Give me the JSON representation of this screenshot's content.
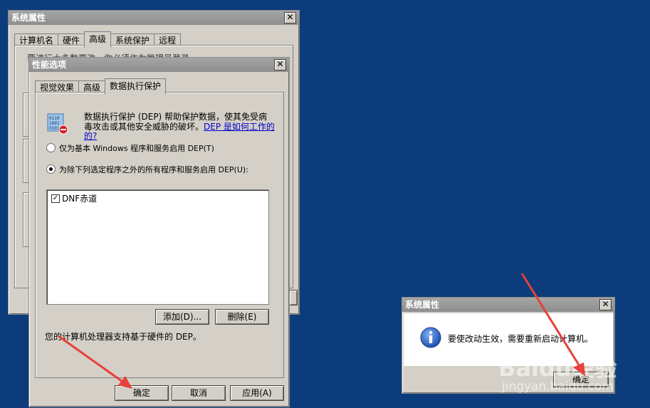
{
  "back_window": {
    "title": "系统属性",
    "tabs": [
      "计算机名",
      "硬件",
      "高级",
      "系统保护",
      "远程"
    ],
    "active_tab": "高级",
    "partial_text": "要进行大多数更改，你必须作为管理员登录。"
  },
  "perf_dialog": {
    "title": "性能选项",
    "tabs": [
      "视觉效果",
      "高级",
      "数据执行保护"
    ],
    "active_tab": "数据执行保护",
    "description_line1": "数据执行保护 (DEP) 帮助保护数据，使其免受病",
    "description_line2": "毒攻击或其他安全威胁的破坏。",
    "link_part1": "DEP 是如何工作的",
    "link_part2": "的?",
    "radio1_label": "仅为基本 Windows 程序和服务启用 DEP(T)",
    "radio2_label": "为除下列选定程序之外的所有程序和服务启用 DEP(U):",
    "list_items": [
      {
        "label": "DNF赤道",
        "checked": true
      }
    ],
    "add_button": "添加(D)...",
    "remove_button": "删除(E)",
    "hardware_note": "您的计算机处理器支持基于硬件的 DEP。",
    "ok_button": "确定",
    "cancel_button": "取消",
    "apply_button": "应用(A)"
  },
  "message_box": {
    "title": "系统属性",
    "message": "要使改动生效，需要重新启动计算机。",
    "ok_button": "确定"
  },
  "watermark": {
    "brand": "Baidu经验",
    "url": "jingyan.baidu.com"
  },
  "colors": {
    "desktop": "#0c3c7b",
    "dialog_face": "#d4d0c8",
    "titlebar": "#999999",
    "annotation_arrow": "#e8403a",
    "link": "#0000cc"
  }
}
